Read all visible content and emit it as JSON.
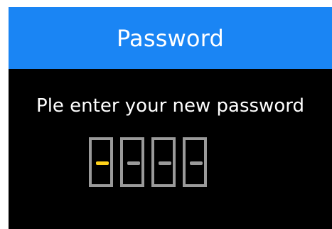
{
  "dialog": {
    "title": "Password",
    "prompt": "Ple enter your new password"
  },
  "pin": {
    "length": 4,
    "active_index": 0,
    "colors": {
      "active_dash": "#ffd21a",
      "inactive_dash": "#9a9a9a",
      "border": "#9a9a9a"
    }
  },
  "colors": {
    "header_bg": "#1a85f4",
    "body_bg": "#000000",
    "text": "#ffffff"
  }
}
